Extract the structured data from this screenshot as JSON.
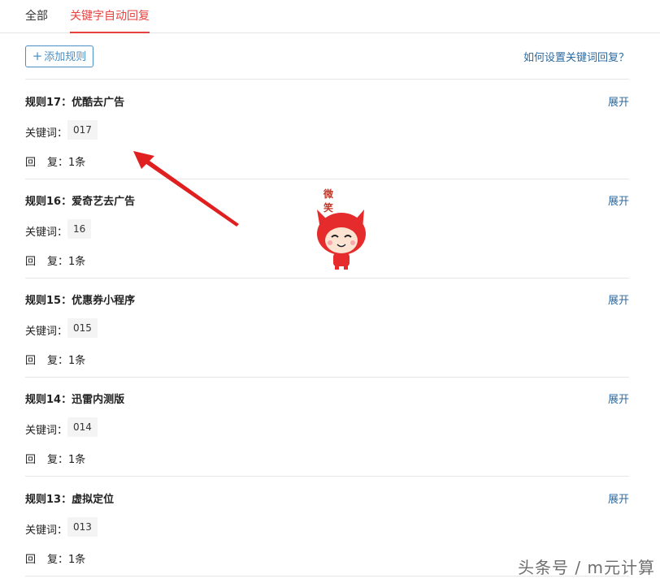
{
  "tabs": [
    {
      "label": "全部",
      "active": false
    },
    {
      "label": "关键字自动回复",
      "active": true
    }
  ],
  "toolbar": {
    "add_label": "添加规则",
    "help_link": "如何设置关键词回复？"
  },
  "rules": [
    {
      "title": "规则17：优酷去广告",
      "expand": "展开",
      "kw_label": "关键词：",
      "keyword": "017",
      "reply": "1条"
    },
    {
      "title": "规则16：爱奇艺去广告",
      "expand": "展开",
      "kw_label": "关键词：",
      "keyword": "16",
      "reply": "1条"
    },
    {
      "title": "规则15：优惠券小程序",
      "expand": "展开",
      "kw_label": "关键词：",
      "keyword": "015",
      "reply": "1条"
    },
    {
      "title": "规则14：迅雷内测版",
      "expand": "展开",
      "kw_label": "关键词：",
      "keyword": "014",
      "reply": "1条"
    },
    {
      "title": "规则13：虚拟定位",
      "expand": "展开",
      "kw_label": "关键词：",
      "keyword": "013",
      "reply": "1条"
    }
  ],
  "reply_label_a": "回",
  "reply_label_b": "复：",
  "sticker": {
    "caption": "微笑",
    "icon": "fox-smile-sticker"
  },
  "annotation": {
    "icon": "red-arrow-pointer"
  },
  "watermark": "头条号 / m元计算",
  "colors": {
    "accent": "#e64340",
    "link": "#2d6aa0",
    "button_border": "#4a90c6"
  }
}
